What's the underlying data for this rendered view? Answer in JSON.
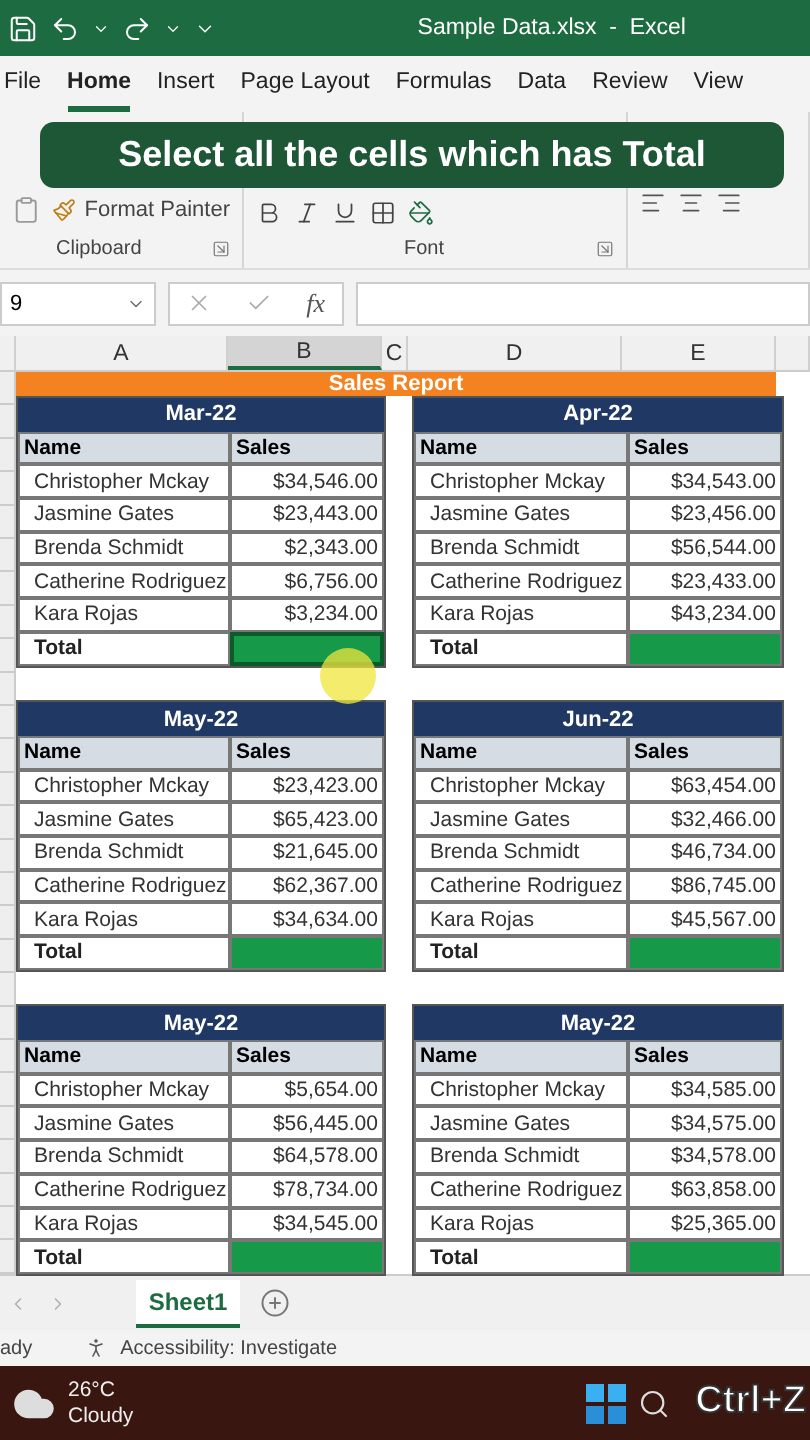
{
  "window": {
    "title": "Sample Data.xlsx  -  Excel"
  },
  "ribbon_tabs": [
    {
      "label": "File",
      "selected": false
    },
    {
      "label": "Home",
      "selected": true
    },
    {
      "label": "Insert",
      "selected": false
    },
    {
      "label": "Page Layout",
      "selected": false
    },
    {
      "label": "Formulas",
      "selected": false
    },
    {
      "label": "Data",
      "selected": false
    },
    {
      "label": "Review",
      "selected": false
    },
    {
      "label": "View",
      "selected": false
    }
  ],
  "ribbon": {
    "format_painter": "Format Painter",
    "groups": [
      "Clipboard",
      "Font"
    ]
  },
  "caption": "Select all the cells which has Total",
  "formula_bar": {
    "name_box": "9",
    "fx": "fx"
  },
  "sheet": {
    "columns": [
      {
        "label": "A",
        "selected": false
      },
      {
        "label": "B",
        "selected": true
      },
      {
        "label": "C",
        "selected": false
      },
      {
        "label": "D",
        "selected": false
      },
      {
        "label": "E",
        "selected": false
      }
    ],
    "title": "Sales Report",
    "tables": [
      {
        "month": "Mar-22",
        "headers": [
          "Name",
          "Sales"
        ],
        "total_label": "Total",
        "total_selected": true,
        "rows": [
          {
            "name": "Christopher Mckay",
            "sales": "$34,546.00"
          },
          {
            "name": "Jasmine Gates",
            "sales": "$23,443.00"
          },
          {
            "name": "Brenda Schmidt",
            "sales": "$2,343.00"
          },
          {
            "name": "Catherine Rodriguez",
            "sales": "$6,756.00"
          },
          {
            "name": "Kara Rojas",
            "sales": "$3,234.00"
          }
        ]
      },
      {
        "month": "Apr-22",
        "headers": [
          "Name",
          "Sales"
        ],
        "total_label": "Total",
        "total_selected": false,
        "rows": [
          {
            "name": "Christopher Mckay",
            "sales": "$34,543.00"
          },
          {
            "name": "Jasmine Gates",
            "sales": "$23,456.00"
          },
          {
            "name": "Brenda Schmidt",
            "sales": "$56,544.00"
          },
          {
            "name": "Catherine Rodriguez",
            "sales": "$23,433.00"
          },
          {
            "name": "Kara Rojas",
            "sales": "$43,234.00"
          }
        ]
      },
      {
        "month": "May-22",
        "headers": [
          "Name",
          "Sales"
        ],
        "total_label": "Total",
        "total_selected": false,
        "rows": [
          {
            "name": "Christopher Mckay",
            "sales": "$23,423.00"
          },
          {
            "name": "Jasmine Gates",
            "sales": "$65,423.00"
          },
          {
            "name": "Brenda Schmidt",
            "sales": "$21,645.00"
          },
          {
            "name": "Catherine Rodriguez",
            "sales": "$62,367.00"
          },
          {
            "name": "Kara Rojas",
            "sales": "$34,634.00"
          }
        ]
      },
      {
        "month": "Jun-22",
        "headers": [
          "Name",
          "Sales"
        ],
        "total_label": "Total",
        "total_selected": false,
        "rows": [
          {
            "name": "Christopher Mckay",
            "sales": "$63,454.00"
          },
          {
            "name": "Jasmine Gates",
            "sales": "$32,466.00"
          },
          {
            "name": "Brenda Schmidt",
            "sales": "$46,734.00"
          },
          {
            "name": "Catherine Rodriguez",
            "sales": "$86,745.00"
          },
          {
            "name": "Kara Rojas",
            "sales": "$45,567.00"
          }
        ]
      },
      {
        "month": "May-22",
        "headers": [
          "Name",
          "Sales"
        ],
        "total_label": "Total",
        "total_selected": false,
        "rows": [
          {
            "name": "Christopher Mckay",
            "sales": "$5,654.00"
          },
          {
            "name": "Jasmine Gates",
            "sales": "$56,445.00"
          },
          {
            "name": "Brenda Schmidt",
            "sales": "$64,578.00"
          },
          {
            "name": "Catherine Rodriguez",
            "sales": "$78,734.00"
          },
          {
            "name": "Kara Rojas",
            "sales": "$34,545.00"
          }
        ]
      },
      {
        "month": "May-22",
        "headers": [
          "Name",
          "Sales"
        ],
        "total_label": "Total",
        "total_selected": false,
        "rows": [
          {
            "name": "Christopher Mckay",
            "sales": "$34,585.00"
          },
          {
            "name": "Jasmine Gates",
            "sales": "$34,575.00"
          },
          {
            "name": "Brenda Schmidt",
            "sales": "$34,578.00"
          },
          {
            "name": "Catherine Rodriguez",
            "sales": "$63,858.00"
          },
          {
            "name": "Kara Rojas",
            "sales": "$25,365.00"
          }
        ]
      }
    ]
  },
  "sheet_tabs": [
    {
      "label": "Sheet1",
      "selected": true
    }
  ],
  "status_bar": {
    "mode": "ady",
    "accessibility": "Accessibility: Investigate"
  },
  "taskbar": {
    "temperature": "26°C",
    "weather": "Cloudy"
  },
  "key_overlay": "Ctrl+Z"
}
